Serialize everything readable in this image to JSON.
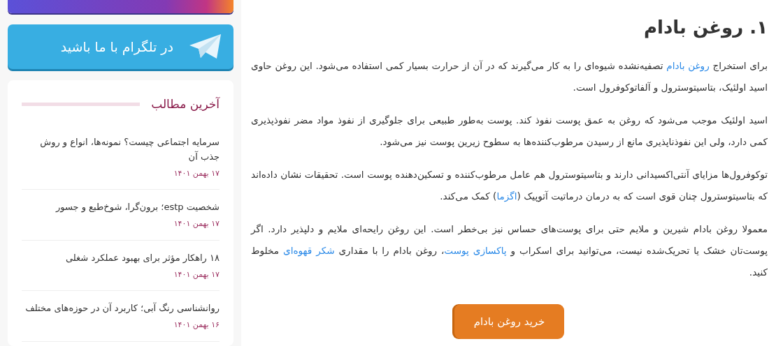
{
  "sidebar": {
    "telegram_banner": {
      "label": "در تلگرام با ما باشید"
    },
    "latest_posts": {
      "title": "آخرین مطالب",
      "items": [
        {
          "title": "سرمایه اجتماعی چیست؟ نمونه‌ها، انواع و روش جذب آن",
          "date": "۱۷ بهمن ۱۴۰۱"
        },
        {
          "title": "شخصیت estp؛ برون‌گرا، شوخ‌طبع و جسور",
          "date": "۱۷ بهمن ۱۴۰۱"
        },
        {
          "title": "۱۸ راهکار مؤثر برای بهبود عملکرد شغلی",
          "date": "۱۷ بهمن ۱۴۰۱"
        },
        {
          "title": "روانشناسی رنگ آبی؛ کاربرد آن در حوزه‌های مختلف",
          "date": "۱۶ بهمن ۱۴۰۱"
        }
      ]
    }
  },
  "article": {
    "heading": "۱. روغن بادام",
    "paragraphs": [
      [
        {
          "text": "برای استخراج ",
          "link": false
        },
        {
          "text": "روغن بادام",
          "link": true
        },
        {
          "text": " تصفیه‌نشده شیوه‌ای را به کار می‌گیرند که در آن از حرارت بسیار کمی استفاده می‌شود. این روغن حاوی اسید اولئیک، بتاسیتوسترول و آلفاتوکوفرول است.",
          "link": false
        }
      ],
      [
        {
          "text": "اسید اولئیک موجب می‌شود که روغن به عمق پوست نفوذ کند. پوست به‌طور طبیعی برای جلوگیری از نفوذ مواد مضر نفوذپذیری کمی دارد، ولی این نفوذناپذیری مانع از رسیدن مرطوب‌کننده‌ها به سطوح زیرین پوست نیز می‌شود.",
          "link": false
        }
      ],
      [
        {
          "text": "توکوفرول‌ها مزایای آنتی‌اکسیدانی دارند و بتاسیتوسترول هم عامل مرطوب‌کننده و تسکین‌دهنده پوست است. تحقیقات نشان داده‌اند که بتاسیتوسترول چنان قوی است که به درمان درماتیت آتوپیک (",
          "link": false
        },
        {
          "text": "اگزما",
          "link": true
        },
        {
          "text": ") کمک می‌کند.",
          "link": false
        }
      ],
      [
        {
          "text": "معمولا روغن بادام شیرین و ملایم حتی برای پوست‌های حساس نیز بی‌خطر است. این روغن رایحه‌ای ملایم و دلپذیر دارد. اگر پوست‌تان خشک یا تحریک‌شده نیست، می‌توانید برای اسکراب و ",
          "link": false
        },
        {
          "text": "پاکسازی پوست",
          "link": true
        },
        {
          "text": "، روغن بادام را با مقداری ",
          "link": false
        },
        {
          "text": "شکر قهوه‌ای",
          "link": true
        },
        {
          "text": " مخلوط کنید.",
          "link": false
        }
      ]
    ],
    "button": "خرید روغن بادام"
  }
}
